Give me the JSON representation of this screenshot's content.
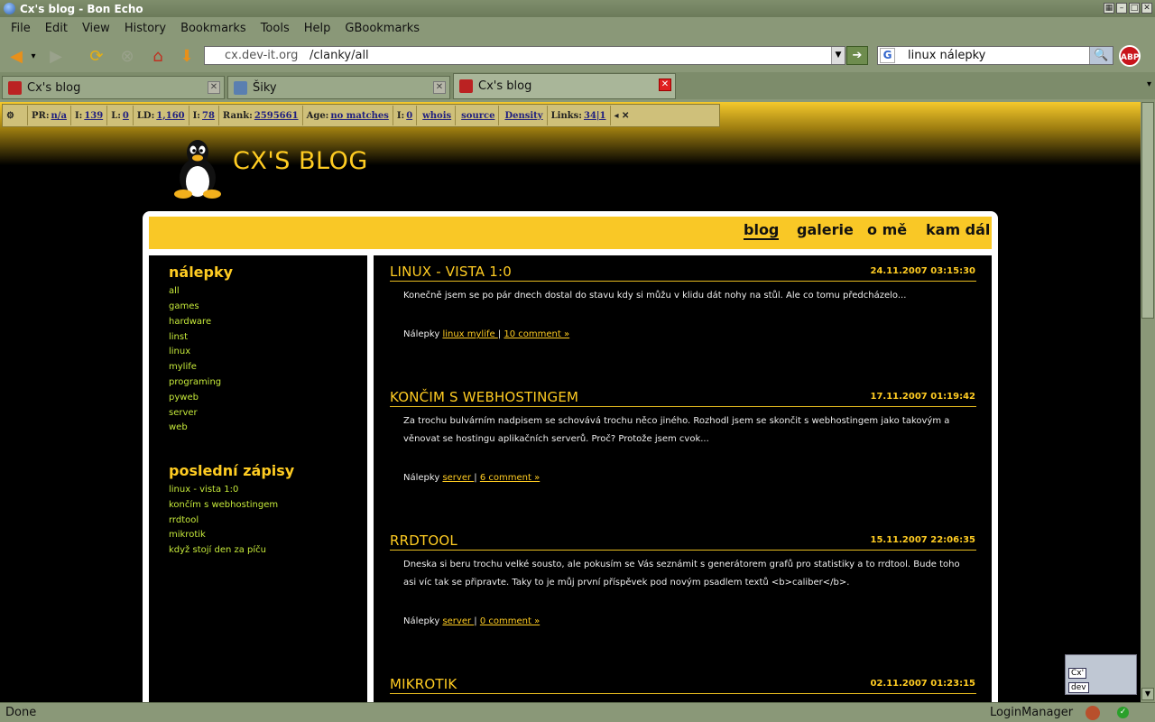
{
  "window": {
    "title": "Cx's blog - Bon Echo"
  },
  "menu": [
    "File",
    "Edit",
    "View",
    "History",
    "Bookmarks",
    "Tools",
    "Help",
    "GBookmarks"
  ],
  "url": {
    "host": "cx.dev-it.org",
    "path": "/clanky/all"
  },
  "search": {
    "value": "linux nálepky",
    "engine": "G"
  },
  "adblock": "ABP",
  "tabs": [
    {
      "label": "Cx's blog",
      "active": false
    },
    {
      "label": "Šiky",
      "active": false
    },
    {
      "label": "Cx's blog",
      "active": true
    }
  ],
  "seo": [
    {
      "label": "PR:",
      "value": "n/a"
    },
    {
      "label": "I:",
      "value": "139"
    },
    {
      "label": "L:",
      "value": "0"
    },
    {
      "label": "LD:",
      "value": "1,160"
    },
    {
      "label": "I:",
      "value": "78"
    },
    {
      "label": "Rank:",
      "value": "2595661"
    },
    {
      "label": "Age:",
      "value": "no matches"
    },
    {
      "label": "I:",
      "value": "0"
    },
    {
      "label": "",
      "value": "whois"
    },
    {
      "label": "",
      "value": "source"
    },
    {
      "label": "",
      "value": "Density"
    },
    {
      "label": "Links:",
      "value": "34|1"
    }
  ],
  "blog": {
    "title": "CX'S BLOG",
    "nav": [
      "blog",
      "galerie",
      "o mě",
      "kam dál"
    ],
    "sidebar": {
      "tags_heading": "nálepky",
      "tags": [
        "all",
        "games",
        "hardware",
        "linst",
        "linux",
        "mylife",
        "programing",
        "pyweb",
        "server",
        "web"
      ],
      "recent_heading": "poslední zápisy",
      "recent": [
        "linux - vista 1:0",
        "končím s webhostingem",
        "rrdtool",
        "mikrotik",
        "když stojí den za píču"
      ]
    },
    "posts": [
      {
        "title": "LINUX - VISTA 1:0",
        "date": "24.11.2007 03:15:30",
        "text": "Konečně jsem se po pár dnech dostal do stavu kdy si můžu v klidu dát nohy na stůl. Ale co tomu předcházelo...",
        "tags_label": "Nálepky",
        "tags": "linux mylife ",
        "comments": "10 comment »"
      },
      {
        "title": "KONČIM S WEBHOSTINGEM",
        "date": "17.11.2007 01:19:42",
        "text": "Za trochu bulvárním nadpisem se schovává trochu něco jiného. Rozhodl jsem se skončit s webhostingem jako takovým a věnovat se hostingu aplikačních serverů. Proč? Protože jsem cvok...",
        "tags_label": "Nálepky",
        "tags": "server ",
        "comments": "6 comment »"
      },
      {
        "title": "RRDTOOL",
        "date": "15.11.2007 22:06:35",
        "text": "Dneska si beru trochu velké sousto, ale pokusím se Vás seznámit s generátorem grafů pro statistiky a to rrdtool. Bude toho asi víc tak se připravte. Taky to je můj první příspěvek pod novým psadlem textů <b>caliber</b>.",
        "tags_label": "Nálepky",
        "tags": "server ",
        "comments": "0 comment »"
      },
      {
        "title": "MIKROTIK",
        "date": "02.11.2007 01:23:15"
      }
    ]
  },
  "logo_badge": {
    "line1": "Cx'",
    "line2": "dev"
  },
  "status": {
    "text": "Done",
    "extension": "LoginManager"
  }
}
